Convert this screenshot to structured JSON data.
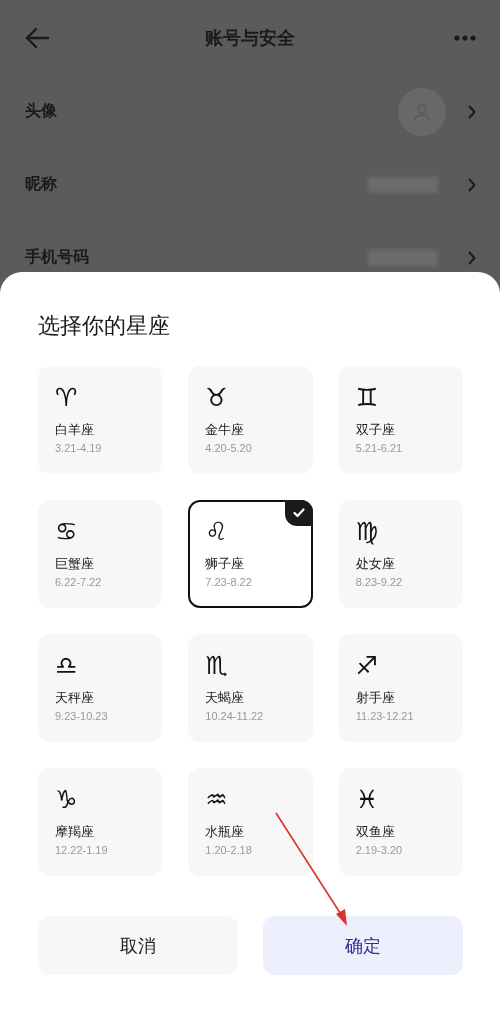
{
  "header": {
    "title": "账号与安全"
  },
  "rows": [
    {
      "kind": "avatar",
      "label": "头像"
    },
    {
      "kind": "hidden",
      "label": "昵称"
    },
    {
      "kind": "hidden",
      "label": "手机号码"
    }
  ],
  "sheet": {
    "title": "选择你的星座",
    "signs": [
      {
        "symbol": "♈",
        "name": "白羊座",
        "dates": "3.21-4.19",
        "selected": false
      },
      {
        "symbol": "♉",
        "name": "金牛座",
        "dates": "4.20-5.20",
        "selected": false
      },
      {
        "symbol": "♊",
        "name": "双子座",
        "dates": "5.21-6.21",
        "selected": false
      },
      {
        "symbol": "♋",
        "name": "巨蟹座",
        "dates": "6.22-7.22",
        "selected": false
      },
      {
        "symbol": "♌",
        "name": "狮子座",
        "dates": "7.23-8.22",
        "selected": true
      },
      {
        "symbol": "♍",
        "name": "处女座",
        "dates": "8.23-9.22",
        "selected": false
      },
      {
        "symbol": "♎",
        "name": "天秤座",
        "dates": "9.23-10.23",
        "selected": false
      },
      {
        "symbol": "♏",
        "name": "天蝎座",
        "dates": "10.24-11.22",
        "selected": false
      },
      {
        "symbol": "♐",
        "name": "射手座",
        "dates": "11.23-12.21",
        "selected": false
      },
      {
        "symbol": "♑",
        "name": "摩羯座",
        "dates": "12.22-1.19",
        "selected": false
      },
      {
        "symbol": "♒",
        "name": "水瓶座",
        "dates": "1.20-2.18",
        "selected": false
      },
      {
        "symbol": "♓",
        "name": "双鱼座",
        "dates": "2.19-3.20",
        "selected": false
      }
    ],
    "buttons": [
      {
        "kind": "cancel",
        "label": "取消"
      },
      {
        "kind": "confirm",
        "label": "确定"
      }
    ]
  },
  "annotation": {
    "kind": "arrow"
  }
}
